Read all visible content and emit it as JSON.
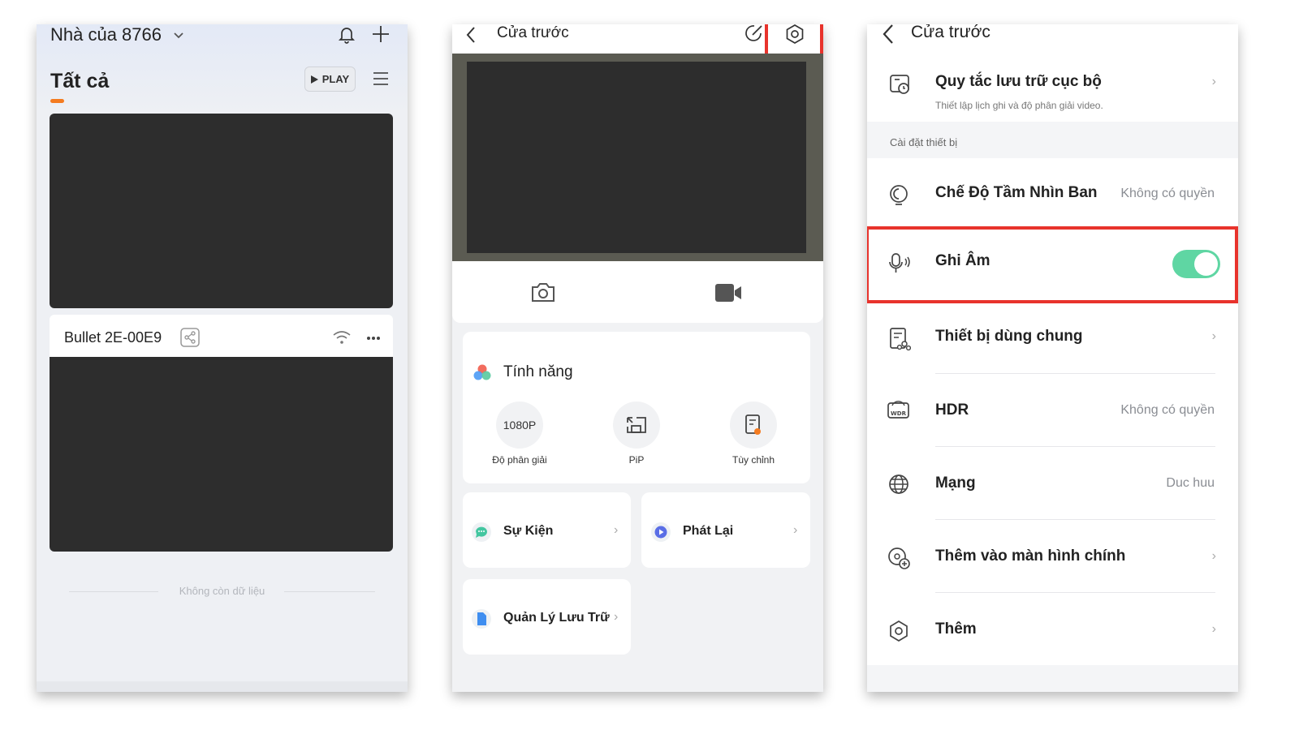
{
  "screens": [
    {
      "home_title": "Nhà của 8766",
      "tab_all": "Tất cả",
      "play_label": "PLAY",
      "device_name": "Bullet 2E-00E9",
      "end_text": "Không còn dữ liệu"
    },
    {
      "title": "Cửa trước",
      "features_title": "Tính năng",
      "features": [
        {
          "icon_text": "1080P",
          "label": "Độ phân giải"
        },
        {
          "label": "PiP"
        },
        {
          "label": "Tùy chỉnh"
        }
      ],
      "events_label": "Sự Kiện",
      "playback_label": "Phát Lại",
      "storage_label": "Quản Lý Lưu Trữ"
    },
    {
      "title": "Cửa trước",
      "storage_rule": {
        "label": "Quy tắc lưu trữ cục bộ",
        "subtitle": "Thiết lập lịch ghi và độ phân giải video."
      },
      "section_label": "Cài đặt thiết bị",
      "rows": [
        {
          "label": "Chế Độ Tầm Nhìn Ban",
          "value": "Không có quyền"
        },
        {
          "label": "Ghi Âm",
          "toggle_on": true
        },
        {
          "label": "Thiết bị dùng chung"
        },
        {
          "label": "HDR",
          "value": "Không có quyền"
        },
        {
          "label": "Mạng",
          "value": "Duc huu"
        },
        {
          "label": "Thêm vào màn hình chính"
        },
        {
          "label": "Thêm"
        }
      ]
    }
  ],
  "colors": {
    "accent_orange": "#f47b20",
    "highlight_red": "#e8332c",
    "toggle_green": "#5fd6a3"
  }
}
